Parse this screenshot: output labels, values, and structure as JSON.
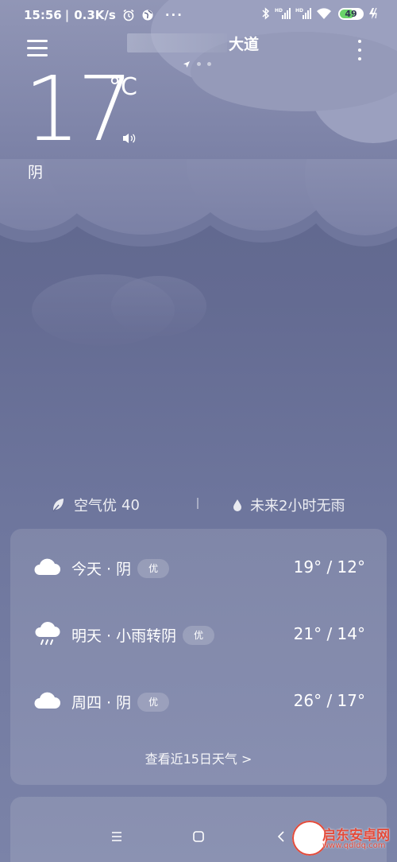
{
  "status_bar": {
    "time": "15:56",
    "network_speed": "0.3K/s",
    "icons": [
      "alarm-icon",
      "globe-icon",
      "more-dots-icon",
      "bluetooth-icon",
      "hd-signal-icon",
      "hd-signal-icon",
      "wifi-icon",
      "charging-icon"
    ],
    "more": "···",
    "battery": "49"
  },
  "header": {
    "location_name": "大道",
    "page_count": 3,
    "active_page": 0
  },
  "current": {
    "temperature": "17",
    "unit": "°C",
    "condition": "阴"
  },
  "info": {
    "air_quality_label": "空气优",
    "air_quality_value": "40",
    "rain_forecast": "未来2小时无雨"
  },
  "forecast": {
    "days": [
      {
        "label": "今天 · 阴",
        "badge": "优",
        "temps": "19° / 12°",
        "icon": "cloudy-icon"
      },
      {
        "label": "明天 · 小雨转阴",
        "badge": "优",
        "temps": "21° / 14°",
        "icon": "light-rain-icon"
      },
      {
        "label": "周四 · 阴",
        "badge": "优",
        "temps": "26° / 17°",
        "icon": "cloudy-icon"
      }
    ],
    "more_link": "查看近15日天气  >"
  },
  "watermark": {
    "text": "启东安卓网",
    "url": "www.qdldq.com"
  },
  "colors": {
    "background_top": "#5c6389",
    "background_bottom": "#7b83a8",
    "cloud": "#8b91b3",
    "card": "rgba(255,255,255,0.12)",
    "watermark_red": "#e34b3b"
  }
}
